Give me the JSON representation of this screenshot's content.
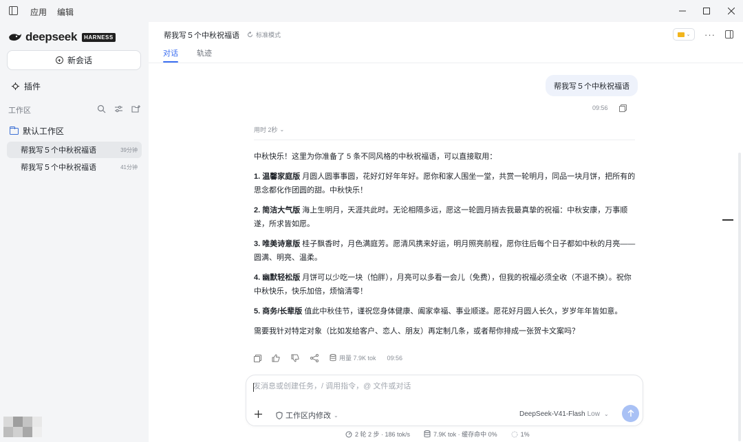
{
  "menu": {
    "app": "应用",
    "edit": "编辑"
  },
  "brand": {
    "name": "deepseek",
    "badge": "HARNESS"
  },
  "sidebar": {
    "new_chat": "新会话",
    "plugins": "插件",
    "workspace_title": "工作区",
    "default_workspace": "默认工作区",
    "chats": [
      {
        "title": "帮我写５个中秋祝福语",
        "time": "39分钟",
        "active": true
      },
      {
        "title": "帮我写５个中秋祝福语",
        "time": "41分钟",
        "active": false
      }
    ]
  },
  "header": {
    "title": "帮我写５个中秋祝福语",
    "mode": "标准模式",
    "tabs": [
      {
        "label": "对话",
        "active": true
      },
      {
        "label": "轨迹",
        "active": false
      }
    ]
  },
  "conversation": {
    "user_message": "帮我写５个中秋祝福语",
    "user_time": "09:56",
    "elapsed": "用时 2秒",
    "intro": "中秋快乐！这里为你准备了 5 条不同风格的中秋祝福语，可以直接取用：",
    "items": [
      {
        "num": "1.",
        "style": "温馨家庭版",
        "text": " 月圆人圆事事圆，花好灯好年年好。愿你和家人围坐一堂，共赏一轮明月，同品一块月饼，把所有的思念都化作团圆的甜。中秋快乐！"
      },
      {
        "num": "2.",
        "style": "简洁大气版",
        "text": " 海上生明月，天涯共此时。无论相隔多远，愿这一轮圆月捎去我最真挚的祝福：中秋安康，万事顺遂，所求皆如愿。"
      },
      {
        "num": "3.",
        "style": "唯美诗意版",
        "text": " 桂子飘香时，月色满庭芳。愿清风携来好运，明月照亮前程，愿你往后每个日子都如中秋的月亮——圆满、明亮、温柔。"
      },
      {
        "num": "4.",
        "style": "幽默轻松版",
        "text": " 月饼可以少吃一块（怕胖），月亮可以多看一会儿（免费），但我的祝福必须全收（不退不换）。祝你中秋快乐，快乐加倍，烦恼清零！"
      },
      {
        "num": "5.",
        "style": "商务/长辈版",
        "text": " 值此中秋佳节，谨祝您身体健康、阖家幸福、事业顺遂。愿花好月圆人长久，岁岁年年皆如意。"
      }
    ],
    "outro": "需要我针对特定对象（比如发给客户、恋人、朋友）再定制几条，或者帮你排成一张贺卡文案吗？",
    "usage": "用量 7.9K tok",
    "answer_time": "09:56"
  },
  "composer": {
    "placeholder": "发消息或创建任务，/ 调用指令，@ 文件或对话",
    "scope": "工作区内修改",
    "model": "DeepSeek-V41-Flash",
    "effort": "Low"
  },
  "status": {
    "turns": "2 轮 2 步 · 186 tok/s",
    "tokens": "7.9K tok · 缓存命中 0%",
    "context": "1%"
  },
  "colors": {
    "accent": "#3a6df0",
    "send_disabled": "#a9c1f5",
    "user_bubble": "#eef2fb",
    "sidebar_bg": "#f4f5f7"
  }
}
